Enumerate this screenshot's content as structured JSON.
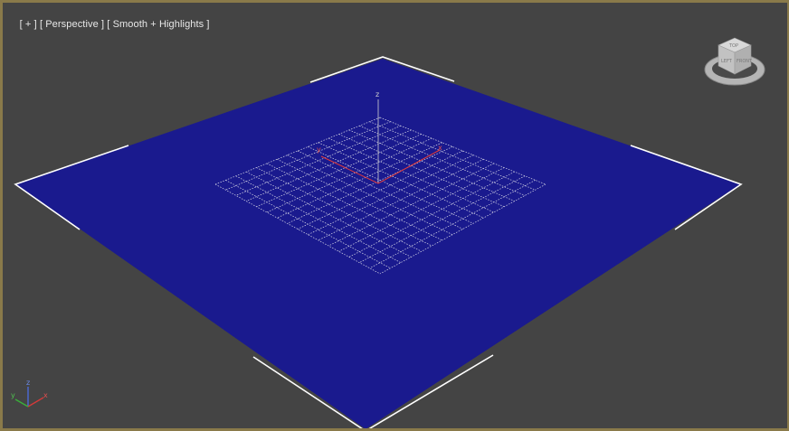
{
  "viewport": {
    "menu_plus": "[ + ]",
    "view_name": "[ Perspective ]",
    "shading_mode": "[ Smooth + Highlights ]"
  },
  "scene": {
    "plane_color": "#1a1a8e",
    "grid_color": "#d8d8e8",
    "background_color": "#444444",
    "border_color": "#8a7a4a",
    "selection_bracket_color": "#ffffff",
    "grid_axis_label": "z",
    "grid_x_label": "x",
    "grid_y_label": "y"
  },
  "viewcube": {
    "top_label": "TOP",
    "left_label": "LEFT",
    "front_label": "FRONT"
  },
  "axis_tripod": {
    "z_label": "z",
    "x_label": "x",
    "y_label": "y",
    "x_color": "#d23a3a",
    "y_color": "#3ab03a",
    "z_color": "#4a6ad8"
  }
}
